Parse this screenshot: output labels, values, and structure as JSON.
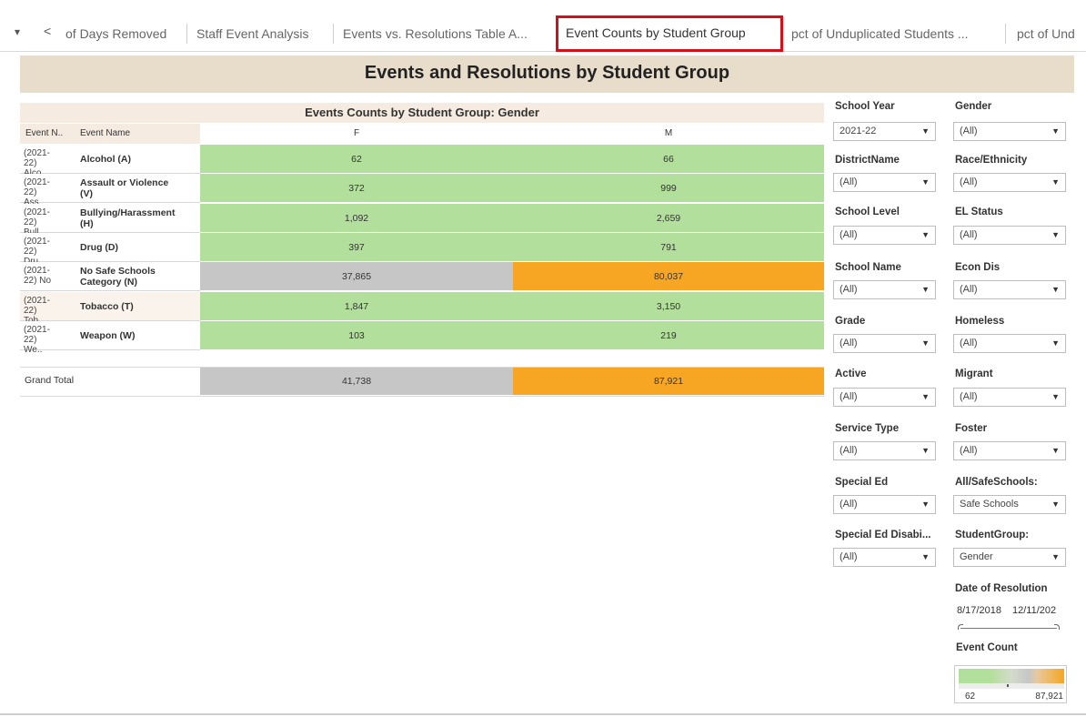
{
  "tabs": {
    "controls": [
      "▾",
      "<"
    ],
    "items": [
      {
        "label": "of Days Removed"
      },
      {
        "label": "Staff Event Analysis"
      },
      {
        "label": "Events vs. Resolutions Table A..."
      },
      {
        "label": "Event Counts by Student Group",
        "active": true
      },
      {
        "label": "pct of Unduplicated Students ..."
      },
      {
        "label": "pct of Und"
      }
    ]
  },
  "dashboard": {
    "title": "Events and Resolutions by Student Group",
    "table_title": "Events Counts by Student Group: Gender",
    "col_event_n": "Event N..",
    "col_event_name": "Event Name",
    "col_f": "F",
    "col_m": "M",
    "rows": [
      {
        "code1": "(2021-",
        "code2": "22) Alco..",
        "name1": "Alcohol (A)",
        "name2": "",
        "f": "62",
        "m": "66",
        "f_color": "green",
        "m_color": "green"
      },
      {
        "code1": "(2021-",
        "code2": "22) Ass..",
        "name1": "Assault or Violence",
        "name2": "(V)",
        "f": "372",
        "m": "999",
        "f_color": "green",
        "m_color": "green"
      },
      {
        "code1": "(2021-",
        "code2": "22) Bull..",
        "name1": "Bullying/Harassment",
        "name2": "(H)",
        "f": "1,092",
        "m": "2,659",
        "f_color": "green",
        "m_color": "green"
      },
      {
        "code1": "(2021-",
        "code2": "22) Dru..",
        "name1": "Drug (D)",
        "name2": "",
        "f": "397",
        "m": "791",
        "f_color": "green",
        "m_color": "green"
      },
      {
        "code1": "(2021-",
        "code2": "22) No ..",
        "name1": "No Safe Schools",
        "name2": "Category (N)",
        "f": "37,865",
        "m": "80,037",
        "f_color": "grey",
        "m_color": "orange"
      },
      {
        "code1": "(2021-",
        "code2": "22) Tob..",
        "name1": "Tobacco (T)",
        "name2": "",
        "f": "1,847",
        "m": "3,150",
        "f_color": "green",
        "m_color": "green"
      },
      {
        "code1": "(2021-",
        "code2": "22) We..",
        "name1": "Weapon (W)",
        "name2": "",
        "f": "103",
        "m": "219",
        "f_color": "green",
        "m_color": "green"
      }
    ],
    "grand_total": {
      "label": "Grand Total",
      "f": "41,738",
      "m": "87,921"
    }
  },
  "filters": {
    "school_year": {
      "label": "School Year",
      "value": "2021-22"
    },
    "gender": {
      "label": "Gender",
      "value": "(All)"
    },
    "district": {
      "label": "DistrictName",
      "value": "(All)"
    },
    "race": {
      "label": "Race/Ethnicity",
      "value": "(All)"
    },
    "school_level": {
      "label": "School Level",
      "value": "(All)"
    },
    "el_status": {
      "label": "EL Status",
      "value": "(All)"
    },
    "school_name": {
      "label": "School Name",
      "value": "(All)"
    },
    "econ_dis": {
      "label": "Econ Dis",
      "value": "(All)"
    },
    "grade": {
      "label": "Grade",
      "value": "(All)"
    },
    "homeless": {
      "label": "Homeless",
      "value": "(All)"
    },
    "active": {
      "label": "Active",
      "value": "(All)"
    },
    "migrant": {
      "label": "Migrant",
      "value": "(All)"
    },
    "service_type": {
      "label": "Service Type",
      "value": "(All)"
    },
    "foster": {
      "label": "Foster",
      "value": "(All)"
    },
    "special_ed": {
      "label": "Special Ed",
      "value": "(All)"
    },
    "safe_schools": {
      "label": "All/SafeSchools:",
      "value": "Safe Schools"
    },
    "special_ed_dis": {
      "label": "Special Ed Disabi...",
      "value": "(All)"
    },
    "student_group": {
      "label": "StudentGroup:",
      "value": "Gender"
    },
    "date_resolution": {
      "label": "Date of Resolution",
      "start": "8/17/2018",
      "end": "12/11/202"
    },
    "legend": {
      "label": "Event Count",
      "min": "62",
      "max": "87,921"
    }
  },
  "colors": {
    "green": "#b3df9c",
    "grey": "#c6c6c6",
    "orange": "#f6a623",
    "title_band": "#e8dccb",
    "active_tab_border": "#d0111b"
  }
}
